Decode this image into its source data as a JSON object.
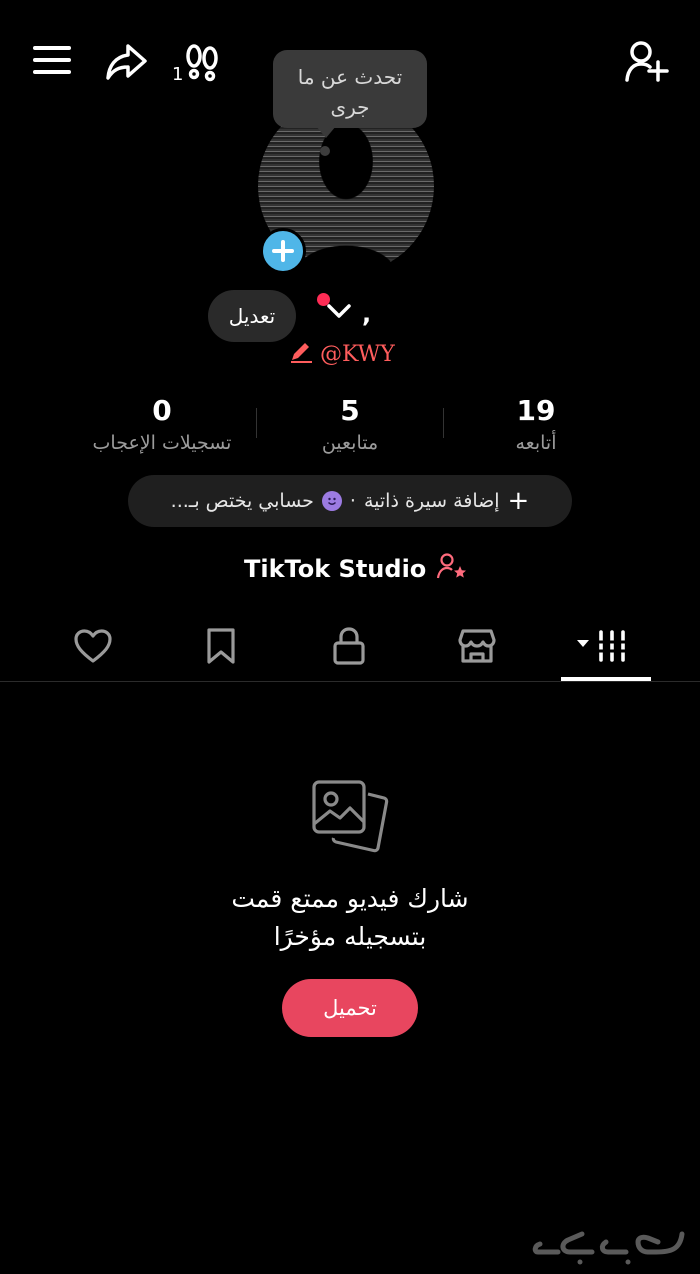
{
  "header": {
    "footprint_count": "1"
  },
  "status_bubble": {
    "text": "تحدث عن ما جرى"
  },
  "profile": {
    "display_name": ",",
    "username": "@KWY",
    "edit_label": "تعديل"
  },
  "stats": {
    "following": {
      "value": "19",
      "label": "أتابعه"
    },
    "followers": {
      "value": "5",
      "label": "متابعين"
    },
    "likes": {
      "value": "0",
      "label": "تسجيلات الإعجاب"
    }
  },
  "bio": {
    "add_label": "إضافة سيرة ذاتية",
    "separator": "·",
    "hint": "حسابي يختص بـ..."
  },
  "studio": {
    "label": "TikTok Studio"
  },
  "tabs": [
    {
      "name": "videos",
      "icon": "grid-icon",
      "active": true
    },
    {
      "name": "shop",
      "icon": "shop-icon"
    },
    {
      "name": "private",
      "icon": "lock-icon"
    },
    {
      "name": "saved",
      "icon": "bookmark-icon"
    },
    {
      "name": "liked",
      "icon": "heart-icon"
    }
  ],
  "empty_state": {
    "line1": "شارك فيديو ممتع قمت",
    "line2": "بتسجيله مؤخرًا",
    "upload_label": "تحميل"
  },
  "watermark": {
    "text": "حراج"
  },
  "colors": {
    "accent": "#fe2c55",
    "upload_button": "#e8465f",
    "avatar_add": "#4fb6e8",
    "username": "#ff5d5d"
  }
}
